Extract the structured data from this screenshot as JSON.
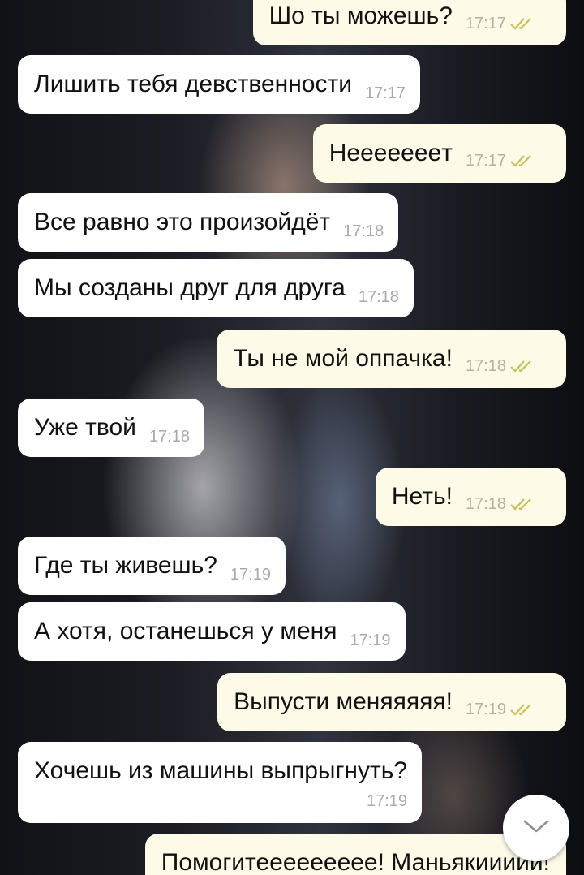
{
  "messages": [
    {
      "dir": "out",
      "text": "Шо ты можешь?",
      "time": "17:17",
      "read": true
    },
    {
      "dir": "in",
      "text": "Лишить тебя девственности",
      "time": "17:17"
    },
    {
      "dir": "out",
      "text": "Неееееeeт",
      "time": "17:17",
      "read": true
    },
    {
      "dir": "in",
      "text": "Все равно это произойдёт",
      "time": "17:18"
    },
    {
      "dir": "in",
      "text": "Мы созданы друг для друга",
      "time": "17:18"
    },
    {
      "dir": "out",
      "text": "Ты не мой оппачка!",
      "time": "17:18",
      "read": true
    },
    {
      "dir": "in",
      "text": "Уже твой",
      "time": "17:18"
    },
    {
      "dir": "out",
      "text": "Неть!",
      "time": "17:18",
      "read": true
    },
    {
      "dir": "in",
      "text": "Где ты живешь?",
      "time": "17:19"
    },
    {
      "dir": "in",
      "text": "А хотя, останешься у меня",
      "time": "17:19"
    },
    {
      "dir": "out",
      "text": "Выпусти меняяяяя!",
      "time": "17:19",
      "read": true
    },
    {
      "dir": "in",
      "text": "Хочешь из машины выпрыгнуть?",
      "time": "17:19"
    },
    {
      "dir": "out",
      "text": "Помогитеееееееее! Маньякиииии!",
      "time": "",
      "read": false
    }
  ],
  "colors": {
    "incoming_bubble": "#ffffff",
    "outgoing_bubble": "#fdfbe8",
    "read_check": "#c9c05a",
    "time_text": "#a9a9a9"
  },
  "scroll_button": {
    "icon": "chevron-down-icon"
  }
}
